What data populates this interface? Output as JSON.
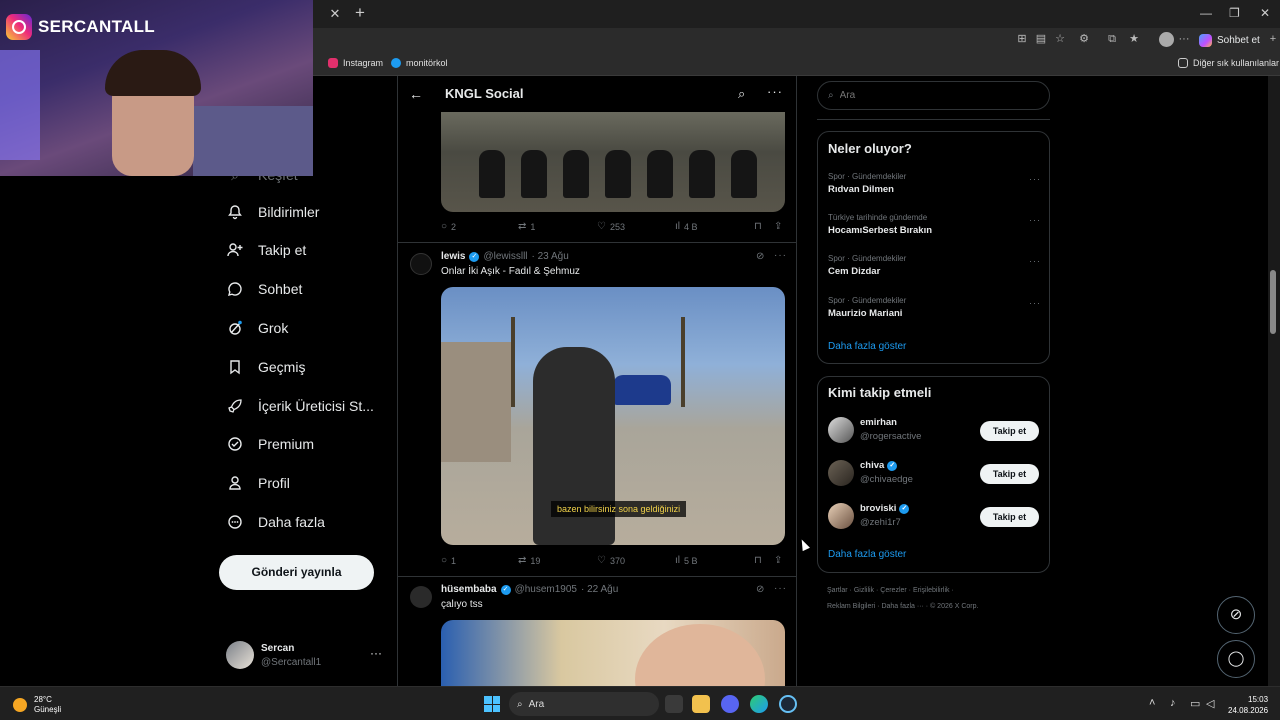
{
  "webcam": {
    "channel_name": "SERCANTALL"
  },
  "browser": {
    "chat_button": "Sohbet et",
    "bookmarks": [
      {
        "label": "Instagram",
        "color": "#e1306c"
      },
      {
        "label": "monitörkol",
        "color": "#1d9bf0"
      }
    ],
    "other_bookmarks": "Diğer sık kullanılanlar"
  },
  "nav": {
    "partial_top": "Keşfet",
    "items": [
      {
        "label": "Bildirimler",
        "icon": "bell-icon"
      },
      {
        "label": "Takip et",
        "icon": "person-add-icon"
      },
      {
        "label": "Sohbet",
        "icon": "chat-bubble-icon"
      },
      {
        "label": "Grok",
        "icon": "grok-icon"
      },
      {
        "label": "Geçmiş",
        "icon": "bookmark-icon"
      },
      {
        "label": "İçerik Üreticisi St...",
        "icon": "rocket-icon"
      },
      {
        "label": "Premium",
        "icon": "verified-badge-icon"
      },
      {
        "label": "Profil",
        "icon": "person-icon"
      },
      {
        "label": "Daha fazla",
        "icon": "more-circle-icon"
      }
    ],
    "post_button": "Gönderi yayınla",
    "account": {
      "name": "Sercan",
      "handle": "@Sercantall1"
    }
  },
  "main": {
    "title": "KNGL Social",
    "posts": [
      {
        "stats": {
          "replies": "2",
          "reposts": "1",
          "likes": "253",
          "views": "4 B"
        }
      },
      {
        "name": "lewis",
        "handle": "@lewisslll",
        "date": "· 23 Ağu",
        "text": "Onlar İki Aşık - Fadıl & Şehmuz",
        "subtitle": "bazen bilirsiniz sona geldiğinizi",
        "stats": {
          "replies": "1",
          "reposts": "19",
          "likes": "370",
          "views": "5 B"
        }
      },
      {
        "name": "hüsembaba",
        "handle": "@husem1905",
        "date": "· 22 Ağu",
        "text": "çalıyo tss"
      }
    ]
  },
  "right": {
    "search_placeholder": "Ara",
    "trends_title": "Neler oluyor?",
    "trends": [
      {
        "category": "Spor · Gündemdekiler",
        "title": "Rıdvan Dilmen"
      },
      {
        "category": "Türkiye tarihinde gündemde",
        "title": "HocamıSerbest Bırakın"
      },
      {
        "category": "Spor · Gündemdekiler",
        "title": "Cem Dizdar"
      },
      {
        "category": "Spor · Gündemdekiler",
        "title": "Maurizio Mariani"
      }
    ],
    "show_more": "Daha fazla göster",
    "who_to_follow_title": "Kimi takip etmeli",
    "suggestions": [
      {
        "name": "emirhan",
        "handle": "@rogersactive",
        "verified": false,
        "button": "Takip et"
      },
      {
        "name": "chiva",
        "handle": "@chivaedge",
        "verified": true,
        "button": "Takip et"
      },
      {
        "name": "broviski",
        "handle": "@zehi1r7",
        "verified": true,
        "button": "Takip et"
      }
    ],
    "footer_line1": "Şartlar  ·  Gizlilik  ·  Çerezler  ·  Erişilebilirlik  ·",
    "footer_line2": "Reklam Bilgileri  ·  Daha fazla ···  ·  © 2026 X Corp."
  },
  "taskbar": {
    "temperature": "28°C",
    "weather": "Güneşli",
    "search_placeholder": "Ara",
    "time": "15:03",
    "date": "24.08.2026"
  }
}
